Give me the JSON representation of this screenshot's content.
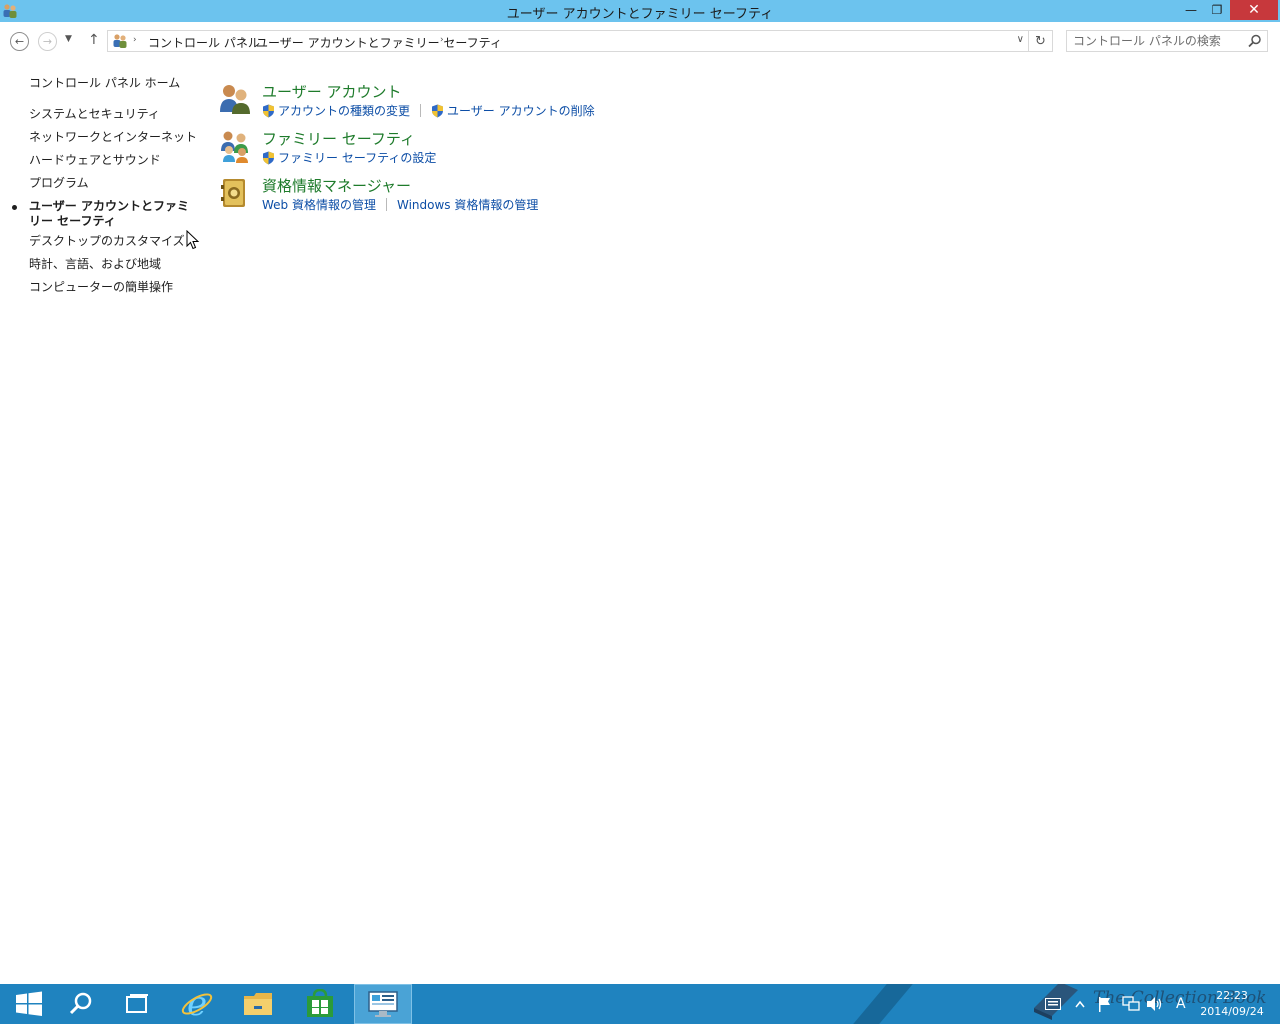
{
  "window": {
    "title": "ユーザー アカウントとファミリー セーフティ",
    "minimize_glyph": "—",
    "maximize_glyph": "❐",
    "close_glyph": "✕"
  },
  "nav": {
    "back_glyph": "←",
    "forward_glyph": "→",
    "recent_glyph": "▼",
    "up_glyph": "↑"
  },
  "breadcrumb": {
    "items": [
      "コントロール パネル",
      "ユーザー アカウントとファミリー セーフティ"
    ],
    "separator": "›",
    "dropdown_glyph": "∨",
    "refresh_glyph": "↻"
  },
  "search": {
    "placeholder": "コントロール パネルの検索",
    "value": ""
  },
  "sidebar": {
    "home": "コントロール パネル ホーム",
    "categories": [
      "システムとセキュリティ",
      "ネットワークとインターネット",
      "ハードウェアとサウンド",
      "プログラム",
      "ユーザー アカウントとファミリー セーフティ",
      "デスクトップのカスタマイズ",
      "時計、言語、および地域",
      "コンピューターの簡単操作"
    ],
    "active_index": 4
  },
  "sections": [
    {
      "title": "ユーザー アカウント",
      "icon": "users-icon",
      "links": [
        {
          "label": "アカウントの種類の変更",
          "shield": true
        },
        {
          "label": "ユーザー アカウントの削除",
          "shield": true
        }
      ]
    },
    {
      "title": "ファミリー セーフティ",
      "icon": "family-safety-icon",
      "links": [
        {
          "label": "ファミリー セーフティの設定",
          "shield": true
        }
      ]
    },
    {
      "title": "資格情報マネージャー",
      "icon": "credential-vault-icon",
      "links": [
        {
          "label": "Web 資格情報の管理",
          "shield": false
        },
        {
          "label": "Windows 資格情報の管理",
          "shield": false
        }
      ]
    }
  ],
  "taskbar": {
    "apps": [
      "start-icon",
      "search-icon",
      "task-view-icon",
      "internet-explorer-icon",
      "file-explorer-icon",
      "store-icon",
      "control-panel-icon"
    ],
    "active_app": "control-panel-icon",
    "ime_indicator": "A",
    "clock_time": "22:23",
    "clock_date": "2014/09/24",
    "watermark": "The Collection Book"
  },
  "colors": {
    "titlebar": "#6cc3ee",
    "section_title": "#1e7b2b",
    "link": "#0d4ea6",
    "taskbar": "#1f83bf",
    "close_button": "#c7383c"
  }
}
